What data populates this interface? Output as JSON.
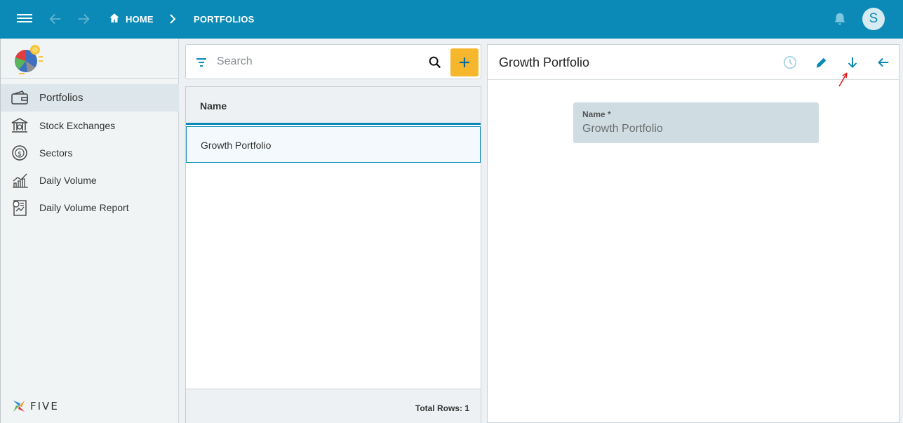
{
  "header": {
    "breadcrumb_home": "HOME",
    "breadcrumb_current": "PORTFOLIOS",
    "avatar_initial": "S",
    "bar_color": "#0c8ab7"
  },
  "sidebar": {
    "items": [
      {
        "label": "Portfolios",
        "icon": "wallet-icon",
        "active": true
      },
      {
        "label": "Stock Exchanges",
        "icon": "bank-icon",
        "active": false
      },
      {
        "label": "Sectors",
        "icon": "dollar-cycle-icon",
        "active": false
      },
      {
        "label": "Daily Volume",
        "icon": "bar-chart-icon",
        "active": false
      },
      {
        "label": "Daily Volume Report",
        "icon": "report-icon",
        "active": false
      }
    ],
    "brand": "FIVE"
  },
  "list": {
    "search_placeholder": "Search",
    "column_name": "Name",
    "rows": [
      "Growth Portfolio"
    ],
    "footer": "Total Rows: 1",
    "add_color": "#f7b72d"
  },
  "detail": {
    "title": "Growth Portfolio",
    "field_label": "Name *",
    "field_value": "Growth Portfolio"
  }
}
